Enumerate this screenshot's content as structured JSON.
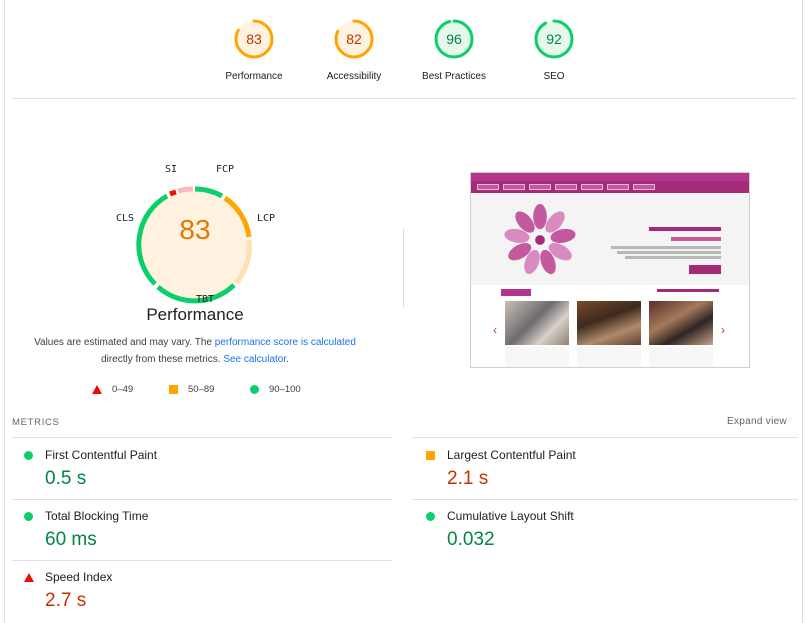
{
  "gauges": [
    {
      "score": "83",
      "label": "Performance",
      "color": "#ffa400",
      "fill": "#fff3e0",
      "text_color": "#c33300",
      "fraction": 0.83
    },
    {
      "score": "82",
      "label": "Accessibility",
      "color": "#ffa400",
      "fill": "#fff3e0",
      "text_color": "#c33300",
      "fraction": 0.82
    },
    {
      "score": "96",
      "label": "Best Practices",
      "color": "#0cce6b",
      "fill": "#e6f7ec",
      "text_color": "#018642",
      "fraction": 0.96
    },
    {
      "score": "92",
      "label": "SEO",
      "color": "#0cce6b",
      "fill": "#e6f7ec",
      "text_color": "#018642",
      "fraction": 0.92
    }
  ],
  "performance": {
    "score": "83",
    "title": "Performance",
    "metric_labels": {
      "si": "SI",
      "fcp": "FCP",
      "lcp": "LCP",
      "tbt": "TBT",
      "cls": "CLS"
    }
  },
  "note": {
    "text1": "Values are estimated and may vary. The ",
    "link1": "performance score is calculated",
    "text2": "directly from these metrics. ",
    "link2": "See calculator",
    "text3": "."
  },
  "legend": [
    {
      "shape": "triangle",
      "range": "0–49"
    },
    {
      "shape": "square",
      "range": "50–89"
    },
    {
      "shape": "circle",
      "range": "90–100"
    }
  ],
  "metrics_header": {
    "title": "METRICS",
    "expand": "Expand view"
  },
  "metrics": [
    {
      "name": "First Contentful Paint",
      "value": "0.5 s",
      "status": "good"
    },
    {
      "name": "Largest Contentful Paint",
      "value": "2.1 s",
      "status": "average"
    },
    {
      "name": "Total Blocking Time",
      "value": "60 ms",
      "status": "good"
    },
    {
      "name": "Cumulative Layout Shift",
      "value": "0.032",
      "status": "good"
    },
    {
      "name": "Speed Index",
      "value": "2.7 s",
      "status": "fail"
    }
  ],
  "thumbnail": {
    "heading": "کانون زنان بازرگان استان خراسان رضوی",
    "subheading": "حامی توانمندسازی بانوان",
    "section": "تازه ترین رویدادهای برگزار شده"
  }
}
